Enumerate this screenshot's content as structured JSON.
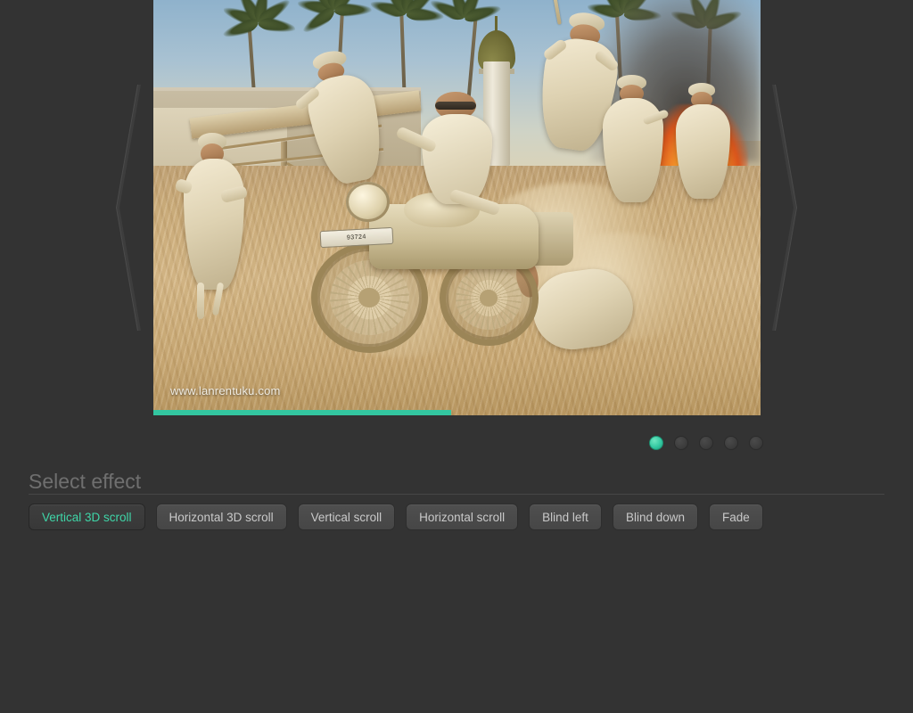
{
  "page": {
    "background_color": "#333333",
    "accent_color": "#33c6a0"
  },
  "slider": {
    "name": "image-carousel",
    "watermark": "www.lanrentuku.com",
    "progress_percent": 49,
    "slide_alt": "Desert chase scene with motorcycle and running villagers",
    "license_plate": "93724",
    "prev_label": "Previous slide",
    "next_label": "Next slide",
    "icons": {
      "prev": "chevron-left-icon",
      "next": "chevron-right-icon"
    }
  },
  "pagination": {
    "active_index": 0,
    "dots": [
      {
        "label": "1"
      },
      {
        "label": "2"
      },
      {
        "label": "3"
      },
      {
        "label": "4"
      },
      {
        "label": "5"
      }
    ]
  },
  "effects": {
    "title": "Select effect",
    "active_index": 0,
    "options": [
      {
        "label": "Vertical 3D scroll"
      },
      {
        "label": "Horizontal 3D scroll"
      },
      {
        "label": "Vertical scroll"
      },
      {
        "label": "Horizontal scroll"
      },
      {
        "label": "Blind left"
      },
      {
        "label": "Blind down"
      },
      {
        "label": "Fade"
      }
    ]
  }
}
